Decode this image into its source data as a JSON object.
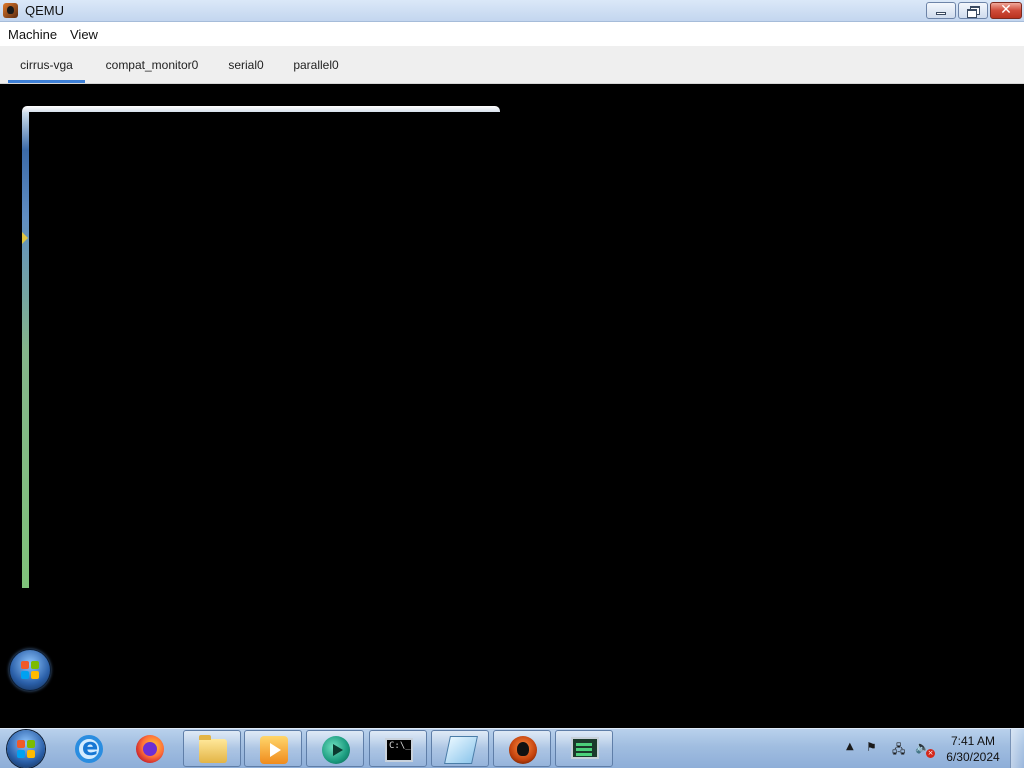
{
  "window": {
    "title": "QEMU",
    "icon": "qemu-icon",
    "controls": [
      "minimize-icon",
      "maximize-icon",
      "close-icon"
    ],
    "close_glyph": "✕"
  },
  "menubar": {
    "items": [
      {
        "label": "Machine"
      },
      {
        "label": "View"
      }
    ]
  },
  "tabs": {
    "active": "cirrus-vga",
    "accent_color": "#3d7fd6",
    "items": [
      {
        "label": "cirrus-vga"
      },
      {
        "label": "compat_monitor0"
      },
      {
        "label": "serial0"
      },
      {
        "label": "parallel0"
      }
    ]
  },
  "guest": {
    "background_color": "#000000",
    "start_orb_icon": "windows-orb-icon"
  },
  "taskbar": {
    "start_icon": "windows-start-icon",
    "apps": [
      {
        "icon": "internet-explorer-icon",
        "open": false
      },
      {
        "icon": "firefox-icon",
        "open": false
      },
      {
        "icon": "file-explorer-icon",
        "open": true
      },
      {
        "icon": "media-player-icon",
        "open": true
      },
      {
        "icon": "round-app-icon",
        "open": true
      },
      {
        "icon": "command-prompt-icon",
        "open": true
      },
      {
        "icon": "notepad-icon",
        "open": true
      },
      {
        "icon": "qemu-icon",
        "open": true
      },
      {
        "icon": "system-monitor-icon",
        "open": true
      }
    ],
    "tray": {
      "icons": [
        "show-hidden-icons-chevron",
        "action-center-flag-icon",
        "network-icon",
        "volume-muted-icon"
      ],
      "chevron_glyph": "▲",
      "flag_glyph": "⚑",
      "network_glyph": "🖧",
      "volume_glyph": "🔈",
      "mute_glyph": "×",
      "time": "7:41 AM",
      "date": "6/30/2024"
    }
  }
}
